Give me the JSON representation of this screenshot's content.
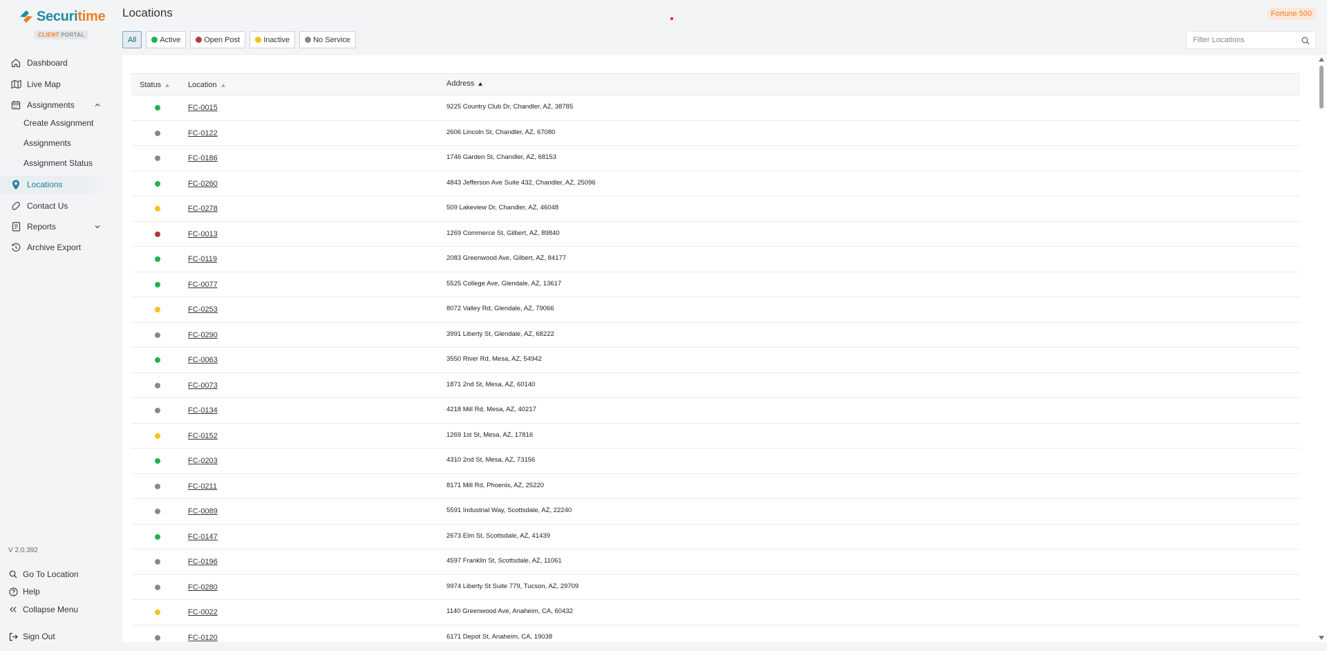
{
  "brand": {
    "name_part1": "Securi",
    "name_part2": "time",
    "badge_part1": "CLIENT",
    "badge_part2": " PORTAL"
  },
  "sidebar": {
    "items": [
      {
        "label": "Dashboard",
        "icon": "home-icon"
      },
      {
        "label": "Live Map",
        "icon": "map-icon"
      },
      {
        "label": "Assignments",
        "icon": "calendar-icon"
      },
      {
        "label": "Locations",
        "icon": "location-pin-icon"
      },
      {
        "label": "Contact Us",
        "icon": "contact-icon"
      },
      {
        "label": "Reports",
        "icon": "report-icon"
      },
      {
        "label": "Archive Export",
        "icon": "history-icon"
      }
    ],
    "sub_items": [
      "Create Assignment",
      "Assignments",
      "Assignment Status"
    ],
    "version": "V 2.0.392",
    "bottom": {
      "go_to_location": "Go To Location",
      "help": "Help",
      "collapse": "Collapse Menu",
      "sign_out": "Sign Out"
    }
  },
  "header": {
    "title": "Locations",
    "org": "Fortune 500"
  },
  "filters": {
    "all": "All",
    "active": "Active",
    "open_post": "Open Post",
    "inactive": "Inactive",
    "no_service": "No Service",
    "search_placeholder": "Filter Locations"
  },
  "colors": {
    "accent": "#1f8ca3",
    "brand_orange": "#ef7d23",
    "active": "#22b24c",
    "open_post": "#b53a3a",
    "inactive": "#f5c21b",
    "no_service": "#888888"
  },
  "table": {
    "headers": {
      "status": "Status",
      "location": "Location",
      "address": "Address"
    },
    "rows": [
      {
        "status": "active",
        "location": "FC-0015",
        "address": "9225 Country Club Dr, Chandler, AZ, 38785"
      },
      {
        "status": "no_service",
        "location": "FC-0122",
        "address": "2606 Lincoln St, Chandler, AZ, 67080"
      },
      {
        "status": "no_service",
        "location": "FC-0186",
        "address": "1746 Garden St, Chandler, AZ, 68153"
      },
      {
        "status": "active",
        "location": "FC-0260",
        "address": "4843 Jefferson Ave Suite 432, Chandler, AZ, 25096"
      },
      {
        "status": "inactive",
        "location": "FC-0278",
        "address": "509 Lakeview Dr, Chandler, AZ, 46048"
      },
      {
        "status": "open_post",
        "location": "FC-0013",
        "address": "1269 Commerce St, Gilbert, AZ, 89840"
      },
      {
        "status": "active",
        "location": "FC-0119",
        "address": "2083 Greenwood Ave, Gilbert, AZ, 84177"
      },
      {
        "status": "active",
        "location": "FC-0077",
        "address": "5525 College Ave, Glendale, AZ, 13617"
      },
      {
        "status": "inactive",
        "location": "FC-0253",
        "address": "8072 Valley Rd, Glendale, AZ, 79066"
      },
      {
        "status": "no_service",
        "location": "FC-0290",
        "address": "3991 Liberty St, Glendale, AZ, 68222"
      },
      {
        "status": "active",
        "location": "FC-0063",
        "address": "3550 River Rd, Mesa, AZ, 54942"
      },
      {
        "status": "no_service",
        "location": "FC-0073",
        "address": "1871 2nd St, Mesa, AZ, 60140"
      },
      {
        "status": "no_service",
        "location": "FC-0134",
        "address": "4218 Mill Rd, Mesa, AZ, 40217"
      },
      {
        "status": "inactive",
        "location": "FC-0152",
        "address": "1269 1st St, Mesa, AZ, 17816"
      },
      {
        "status": "active",
        "location": "FC-0203",
        "address": "4310 2nd St, Mesa, AZ, 73156"
      },
      {
        "status": "no_service",
        "location": "FC-0211",
        "address": "8171 Mill Rd, Phoenix, AZ, 25220"
      },
      {
        "status": "no_service",
        "location": "FC-0089",
        "address": "5591 Industrial Way, Scottsdale, AZ, 22240"
      },
      {
        "status": "active",
        "location": "FC-0147",
        "address": "2673 Elm St, Scottsdale, AZ, 41439"
      },
      {
        "status": "no_service",
        "location": "FC-0196",
        "address": "4597 Franklin St, Scottsdale, AZ, 11061"
      },
      {
        "status": "no_service",
        "location": "FC-0280",
        "address": "9974 Liberty St Suite 779, Tucson, AZ, 29709"
      },
      {
        "status": "inactive",
        "location": "FC-0022",
        "address": "1140 Greenwood Ave, Anaheim, CA, 60432"
      },
      {
        "status": "no_service",
        "location": "FC-0120",
        "address": "6171 Depot St, Anaheim, CA, 19038"
      }
    ]
  }
}
